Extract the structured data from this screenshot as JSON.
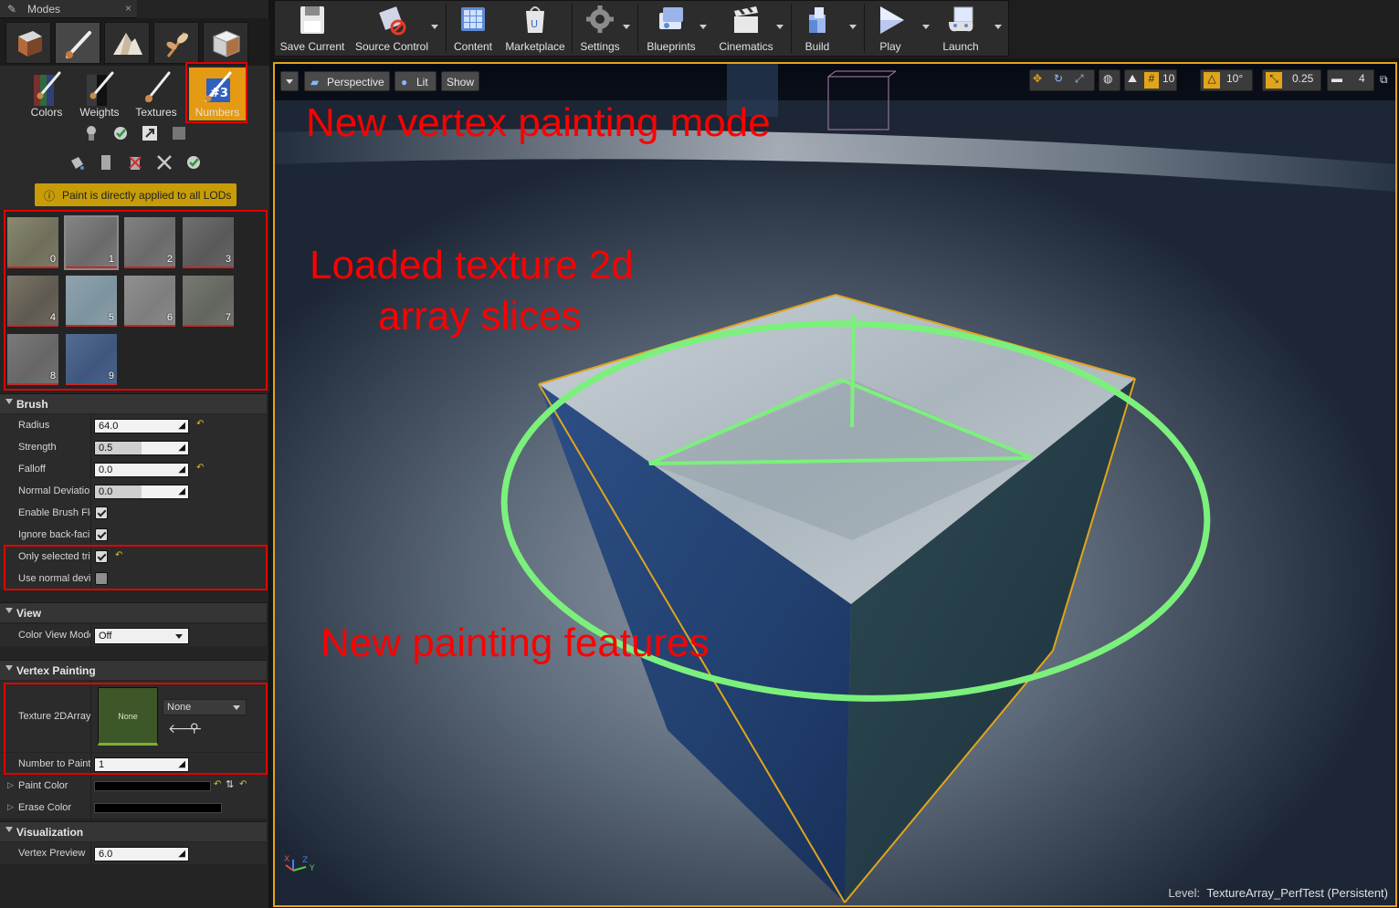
{
  "tab": {
    "title": "Modes",
    "close": "×"
  },
  "paint_modes": [
    {
      "label": "Colors",
      "icon": "colors-brush-icon"
    },
    {
      "label": "Weights",
      "icon": "weights-brush-icon"
    },
    {
      "label": "Textures",
      "icon": "textures-brush-icon"
    },
    {
      "label": "Numbers",
      "icon": "numbers-brush-icon",
      "active": true
    }
  ],
  "lod_notice": "Paint is directly applied to all LODs",
  "texture_slices": [
    "0",
    "1",
    "2",
    "3",
    "4",
    "5",
    "6",
    "7",
    "8",
    "9"
  ],
  "brush": {
    "header": "Brush",
    "radius": {
      "label": "Radius",
      "value": "64.0"
    },
    "strength": {
      "label": "Strength",
      "value": "0.5",
      "fill": 0.5
    },
    "falloff": {
      "label": "Falloff",
      "value": "0.0"
    },
    "normal_deviation": {
      "label": "Normal Deviation",
      "value": "0.0",
      "fill": 0.5
    },
    "enable_brush_flow": {
      "label": "Enable Brush Flow",
      "checked": true
    },
    "ignore_back_facing": {
      "label": "Ignore back-facing",
      "checked": true
    },
    "only_selected": {
      "label": "Only selected triangles",
      "checked": true
    },
    "use_normal_dev": {
      "label": "Use normal deviation",
      "checked": false
    }
  },
  "view": {
    "header": "View",
    "color_view_mode": {
      "label": "Color View Mode",
      "value": "Off"
    }
  },
  "vertex_painting": {
    "header": "Vertex Painting",
    "texture_2darray": {
      "label": "Texture 2DArray",
      "thumb_text": "None",
      "value": "None"
    },
    "number_to_paint": {
      "label": "Number to Paint",
      "value": "1"
    },
    "paint_color": {
      "label": "Paint Color"
    },
    "erase_color": {
      "label": "Erase Color"
    }
  },
  "visualization": {
    "header": "Visualization",
    "vertex_preview": {
      "label": "Vertex Preview",
      "value": "6.0"
    }
  },
  "toolbar": [
    {
      "label": "Save Current",
      "icon": "save-icon"
    },
    {
      "label": "Source Control",
      "icon": "source-control-icon"
    },
    {
      "label": "Content",
      "icon": "content-browser-icon"
    },
    {
      "label": "Marketplace",
      "icon": "marketplace-icon"
    },
    {
      "label": "Settings",
      "icon": "settings-icon"
    },
    {
      "label": "Blueprints",
      "icon": "blueprints-icon"
    },
    {
      "label": "Cinematics",
      "icon": "cinematics-icon"
    },
    {
      "label": "Build",
      "icon": "build-icon"
    },
    {
      "label": "Play",
      "icon": "play-icon"
    },
    {
      "label": "Launch",
      "icon": "launch-icon"
    }
  ],
  "viewport": {
    "perspective": "Perspective",
    "lit": "Lit",
    "show": "Show",
    "grid_snap": "10",
    "rot_snap": "10°",
    "scale_snap": "0.25",
    "cam_speed": "4",
    "level_label": "Level:",
    "level_name": "TextureArray_PerfTest (Persistent)"
  },
  "annotations": {
    "mode": "New vertex painting mode",
    "slices_line1": "Loaded texture 2d",
    "slices_line2": "array slices",
    "features": "New painting features"
  },
  "colors": {
    "accent_orange": "#e49a13",
    "viewport_border": "#e1a51b",
    "annotation_red": "#ff0000",
    "brush_ring": "#7cf07c"
  }
}
